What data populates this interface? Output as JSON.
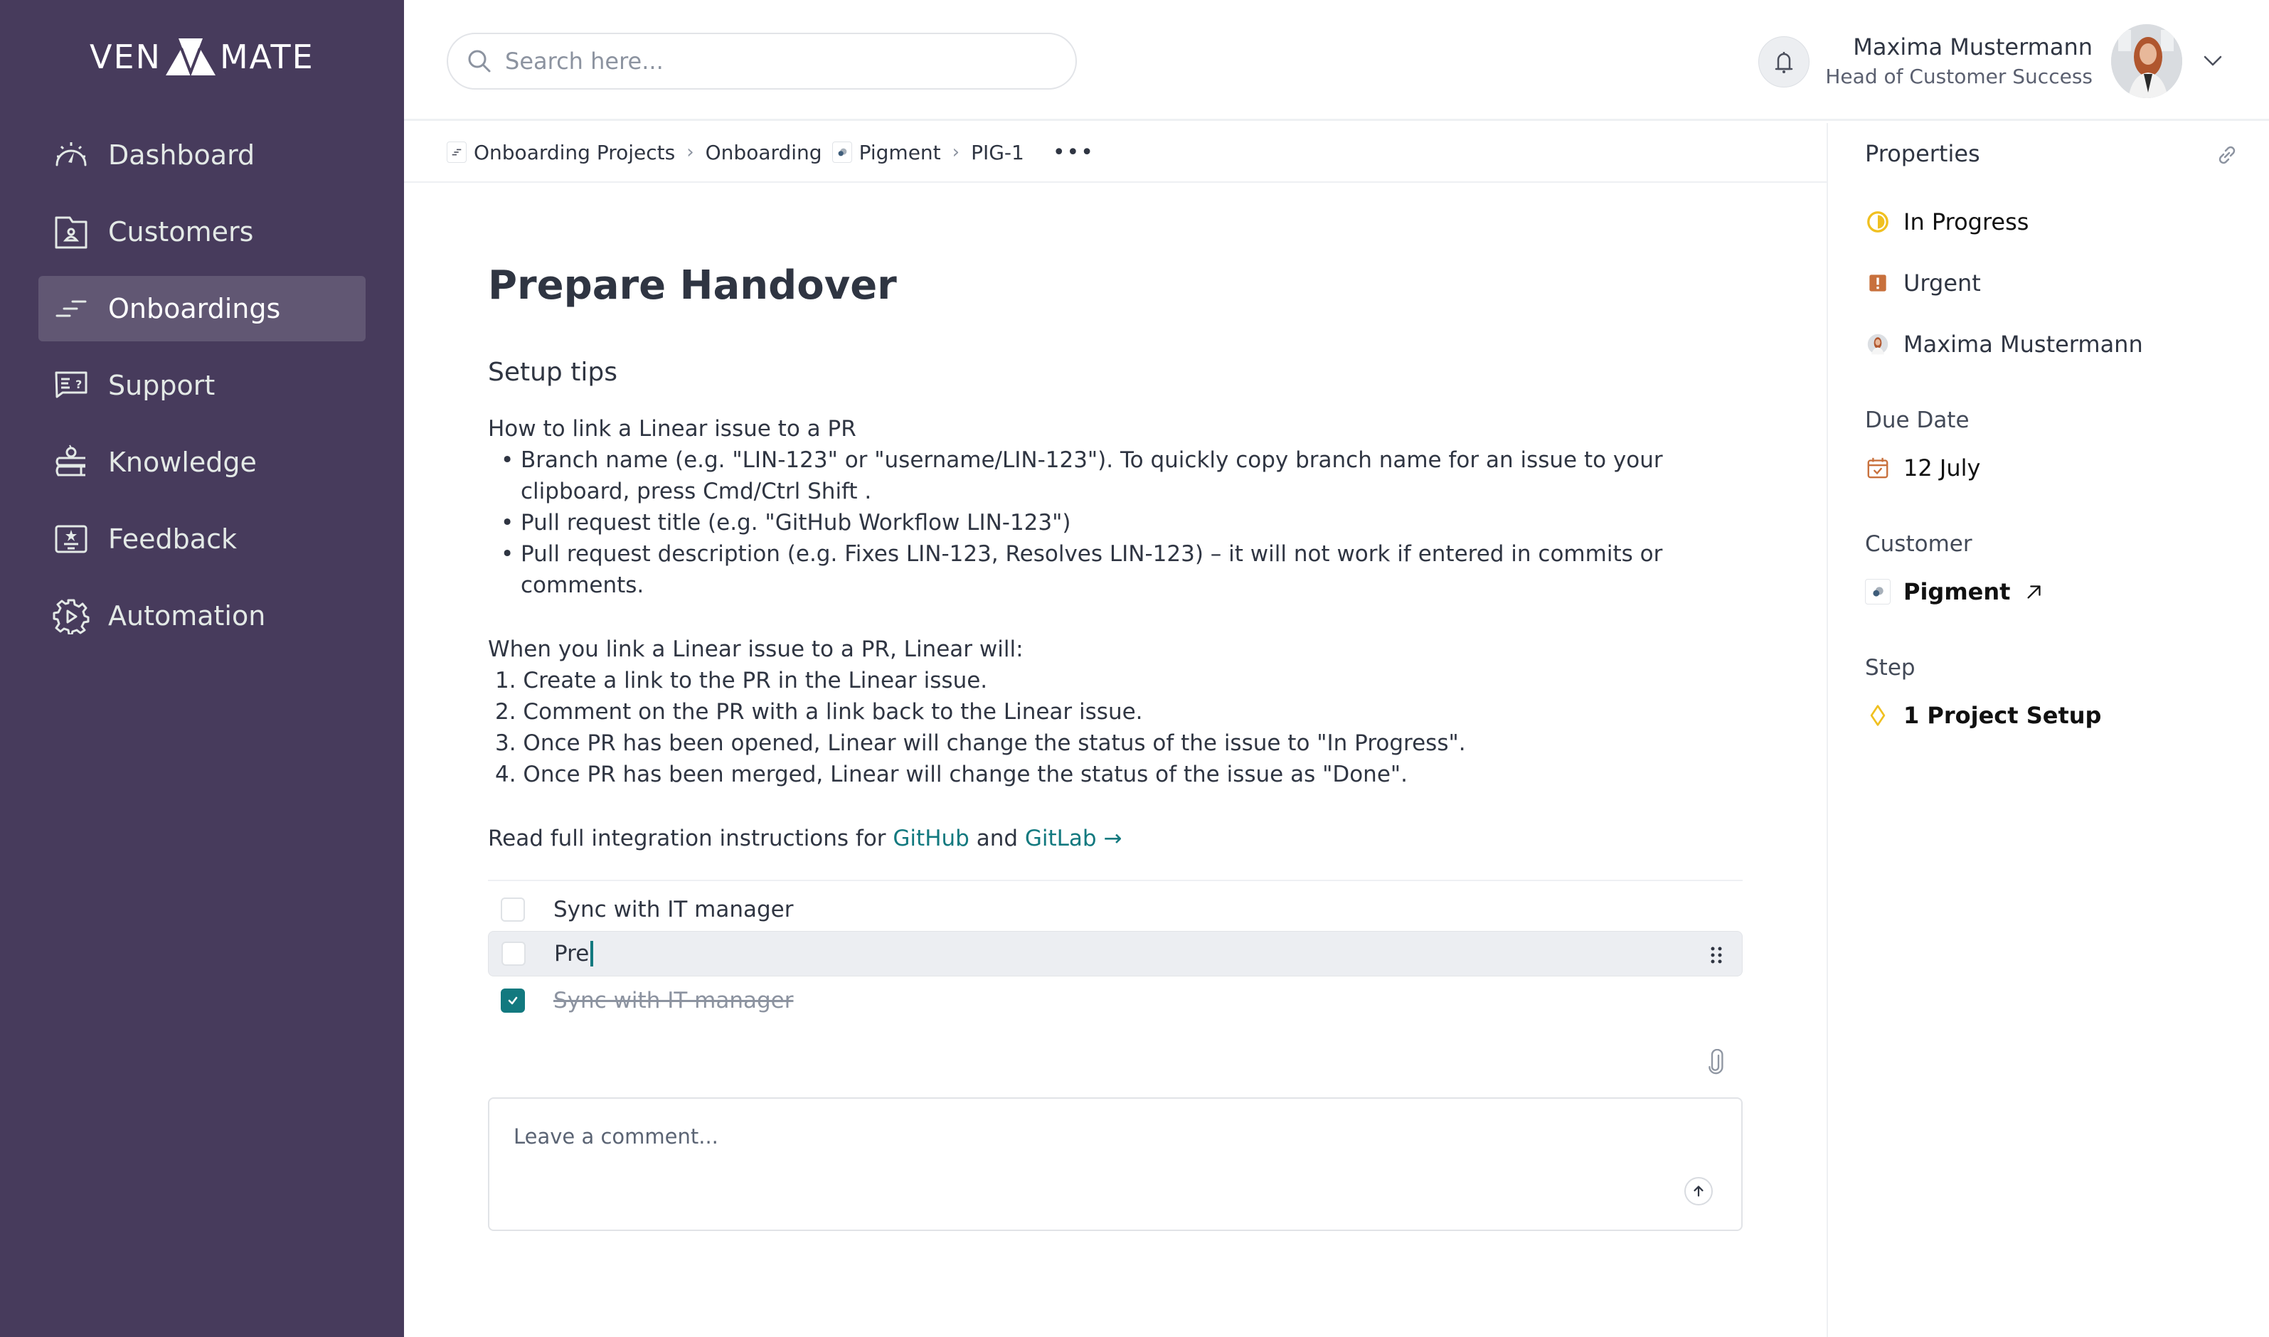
{
  "brand": {
    "left": "VEN",
    "right": "MATE",
    "color": "#473b5c"
  },
  "sidebar": {
    "items": [
      {
        "label": "Dashboard",
        "icon": "dashboard-gauge-icon",
        "active": false
      },
      {
        "label": "Customers",
        "icon": "customer-folder-icon",
        "active": false
      },
      {
        "label": "Onboardings",
        "icon": "onboarding-lines-icon",
        "active": true
      },
      {
        "label": "Support",
        "icon": "support-chat-icon",
        "active": false
      },
      {
        "label": "Knowledge",
        "icon": "knowledge-books-icon",
        "active": false
      },
      {
        "label": "Feedback",
        "icon": "feedback-star-icon",
        "active": false
      },
      {
        "label": "Automation",
        "icon": "automation-gear-icon",
        "active": false
      }
    ]
  },
  "header": {
    "search_placeholder": "Search here...",
    "user_name": "Maxima Mustermann",
    "user_role": "Head of Customer Success"
  },
  "breadcrumb": {
    "items": [
      "Onboarding Projects",
      "Onboarding",
      "Pigment",
      "PIG-1"
    ],
    "more": "•••"
  },
  "task": {
    "title": "Prepare Handover",
    "section_title": "Setup tips",
    "howto_heading": "How to link a Linear issue to a PR",
    "howto_bullets": [
      "Branch name (e.g. \"LIN-123\" or \"username/LIN-123\"). To quickly copy branch name for an issue to your clipboard, press Cmd/Ctrl Shift .",
      "Pull request title (e.g. \"GitHub Workflow LIN-123\")",
      "Pull request description (e.g. Fixes LIN-123, Resolves LIN-123) – it will not work if entered in commits or comments."
    ],
    "when_heading": "When you link a Linear issue to a PR, Linear will:",
    "when_steps": [
      "1. Create a link to the PR in the Linear issue.",
      "2. Comment on the PR with a link back to the Linear issue.",
      "3. Once PR has been opened, Linear will change the status of the issue to \"In Progress\".",
      "4. Once PR has been merged, Linear will change the status of the issue as \"Done\"."
    ],
    "read_prefix": "Read full integration instructions for ",
    "read_link1": "GitHub",
    "read_mid": " and ",
    "read_link2": "GitLab →",
    "link_color": "#12797f"
  },
  "checklist": [
    {
      "text": "Sync with IT manager",
      "checked": false
    },
    {
      "text": "Pre",
      "checked": false,
      "editing": true
    },
    {
      "text": "Sync with IT manager",
      "checked": true
    }
  ],
  "comment": {
    "placeholder": "Leave a comment..."
  },
  "properties": {
    "heading": "Properties",
    "status": {
      "label": "In Progress",
      "color": "#f0c020"
    },
    "priority": {
      "label": "Urgent",
      "color": "#c8703c"
    },
    "assignee": "Maxima Mustermann",
    "due_date_label": "Due Date",
    "due_date": "12 July",
    "customer_label": "Customer",
    "customer": "Pigment",
    "step_label": "Step",
    "step": "1 Project Setup"
  }
}
